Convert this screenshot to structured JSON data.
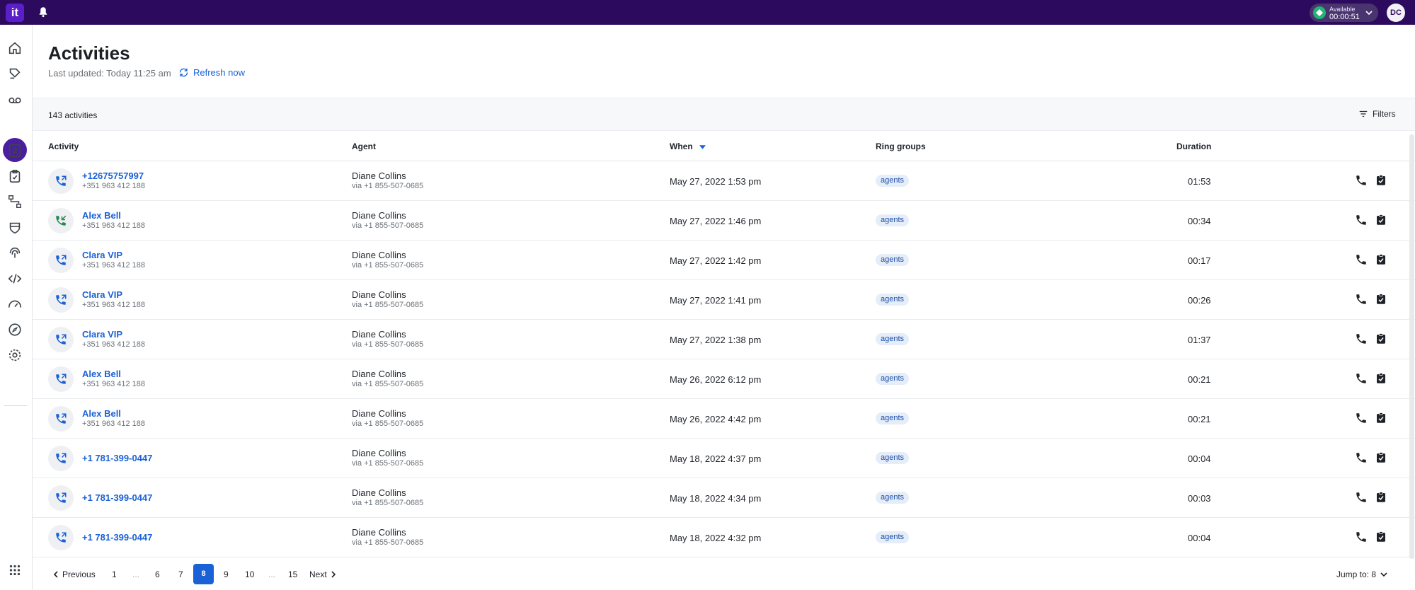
{
  "topbar": {
    "logo": "it",
    "status_label": "Available",
    "status_timer": "00:00:51",
    "avatar_initials": "DC"
  },
  "page": {
    "title": "Activities",
    "last_updated": "Last updated: Today 11:25 am",
    "refresh_label": "Refresh now",
    "count": "143 activities",
    "filters_label": "Filters"
  },
  "table": {
    "headers": {
      "activity": "Activity",
      "agent": "Agent",
      "when": "When",
      "ring_groups": "Ring groups",
      "duration": "Duration"
    },
    "rows": [
      {
        "name": "+12675757997",
        "sub": "+351 963 412 188",
        "agent": "Diane Collins",
        "via": "via +1 855-507-0685",
        "when": "May 27, 2022 1:53 pm",
        "group": "agents",
        "duration": "01:53",
        "icon": "outgoing-call-icon"
      },
      {
        "name": "Alex Bell",
        "sub": "+351 963 412 188",
        "agent": "Diane Collins",
        "via": "via +1 855-507-0685",
        "when": "May 27, 2022 1:46 pm",
        "group": "agents",
        "duration": "00:34",
        "icon": "incoming-call-icon"
      },
      {
        "name": "Clara VIP",
        "sub": "+351 963 412 188",
        "agent": "Diane Collins",
        "via": "via +1 855-507-0685",
        "when": "May 27, 2022 1:42 pm",
        "group": "agents",
        "duration": "00:17",
        "icon": "outgoing-call-icon"
      },
      {
        "name": "Clara VIP",
        "sub": "+351 963 412 188",
        "agent": "Diane Collins",
        "via": "via +1 855-507-0685",
        "when": "May 27, 2022 1:41 pm",
        "group": "agents",
        "duration": "00:26",
        "icon": "outgoing-call-icon"
      },
      {
        "name": "Clara VIP",
        "sub": "+351 963 412 188",
        "agent": "Diane Collins",
        "via": "via +1 855-507-0685",
        "when": "May 27, 2022 1:38 pm",
        "group": "agents",
        "duration": "01:37",
        "icon": "outgoing-call-icon"
      },
      {
        "name": "Alex Bell",
        "sub": "+351 963 412 188",
        "agent": "Diane Collins",
        "via": "via +1 855-507-0685",
        "when": "May 26, 2022 6:12 pm",
        "group": "agents",
        "duration": "00:21",
        "icon": "outgoing-call-icon"
      },
      {
        "name": "Alex Bell",
        "sub": "+351 963 412 188",
        "agent": "Diane Collins",
        "via": "via +1 855-507-0685",
        "when": "May 26, 2022 4:42 pm",
        "group": "agents",
        "duration": "00:21",
        "icon": "outgoing-call-icon"
      },
      {
        "name": "+1 781-399-0447",
        "sub": "",
        "agent": "Diane Collins",
        "via": "via +1 855-507-0685",
        "when": "May 18, 2022 4:37 pm",
        "group": "agents",
        "duration": "00:04",
        "icon": "outgoing-call-icon"
      },
      {
        "name": "+1 781-399-0447",
        "sub": "",
        "agent": "Diane Collins",
        "via": "via +1 855-507-0685",
        "when": "May 18, 2022 4:34 pm",
        "group": "agents",
        "duration": "00:03",
        "icon": "outgoing-call-icon"
      },
      {
        "name": "+1 781-399-0447",
        "sub": "",
        "agent": "Diane Collins",
        "via": "via +1 855-507-0685",
        "when": "May 18, 2022 4:32 pm",
        "group": "agents",
        "duration": "00:04",
        "icon": "outgoing-call-icon"
      }
    ]
  },
  "pagination": {
    "previous": "Previous",
    "next": "Next",
    "pages": [
      "1",
      "...",
      "6",
      "7",
      "8",
      "9",
      "10",
      "...",
      "15"
    ],
    "current": "8",
    "jump_to": "Jump to: 8"
  },
  "colors": {
    "topbar": "#2c0b5e",
    "accent": "#1a61d6",
    "status_green": "#22b573",
    "sidebar_active": "#4a1e9e"
  },
  "sidebar_icons": [
    "home-icon",
    "wallboard-icon",
    "voicemail-icon",
    "activities-icon",
    "contacts-icon",
    "tasks-icon",
    "routing-icon",
    "integrations-icon",
    "fingerprint-icon",
    "api-icon",
    "dashboard-icon",
    "explore-icon",
    "settings-icon",
    "apps-grid-icon"
  ]
}
